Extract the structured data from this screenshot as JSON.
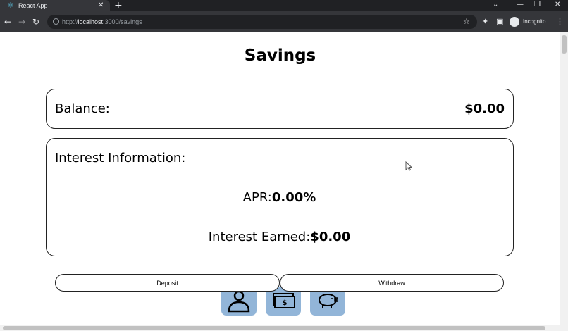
{
  "browser": {
    "tab_title": "React App",
    "favicon": "react-icon",
    "url_scheme": "http://",
    "url_host": "localhost",
    "url_path": ":3000/savings",
    "profile_label": "Incognito"
  },
  "page": {
    "title": "Savings",
    "balance": {
      "label": "Balance:",
      "value": "$0.00"
    },
    "interest": {
      "heading": "Interest Information:",
      "apr_label": "APR:",
      "apr_value": "0.00%",
      "earned_label": "Interest Earned:",
      "earned_value": "$0.00"
    },
    "actions": {
      "deposit_label": "Deposit",
      "withdraw_label": "Withdraw"
    },
    "nav_tiles": [
      "profile-icon",
      "money-icon",
      "piggy-bank-icon"
    ],
    "colors": {
      "tile_bg": "#92b5d8",
      "border": "#222222"
    }
  }
}
